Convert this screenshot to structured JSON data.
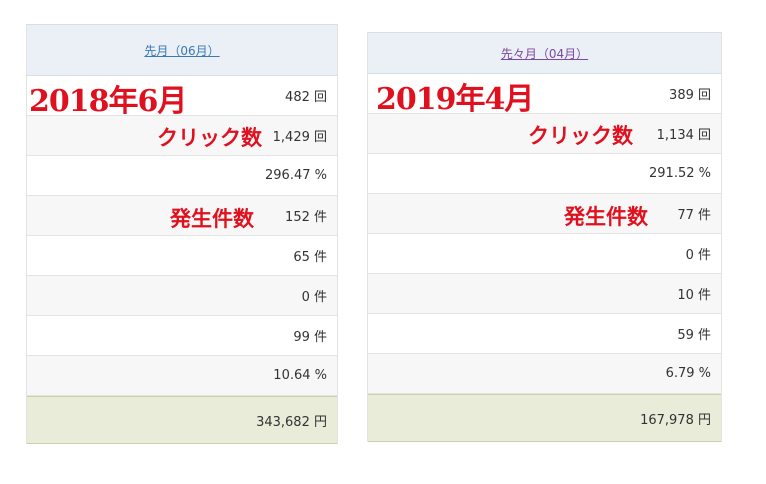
{
  "left": {
    "header_link": "先月（06月）",
    "period_annotation": "2018年6月",
    "rows": [
      "482 回",
      "1,429 回",
      "296.47 %",
      "152 件",
      "65 件",
      "0 件",
      "99 件",
      "10.64 %"
    ],
    "total": "343,682 円",
    "click_annotation": "クリック数",
    "count_annotation": "発生件数"
  },
  "right": {
    "header_link": "先々月（04月）",
    "period_annotation": "2019年4月",
    "rows": [
      "389 回",
      "1,134 回",
      "291.52 %",
      "77 件",
      "0 件",
      "10 件",
      "59 件",
      "6.79 %"
    ],
    "total": "167,978 円",
    "click_annotation": "クリック数",
    "count_annotation": "発生件数"
  },
  "colors": {
    "header_bg": "#eaf0f5",
    "total_bg": "#e8ecd9",
    "annotation": "#e0101e",
    "link_left": "#3a78b5",
    "link_right": "#7a4aa0"
  }
}
